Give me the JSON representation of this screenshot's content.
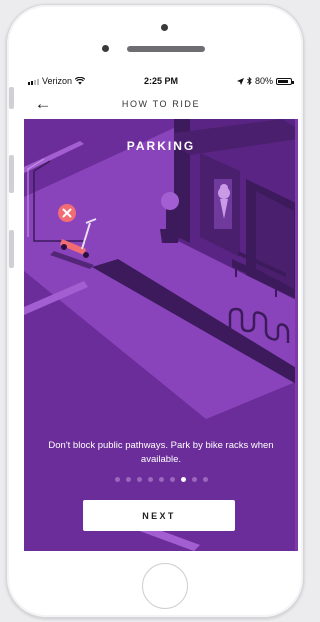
{
  "status_bar": {
    "carrier": "Verizon",
    "time": "2:25 PM",
    "battery": "80%"
  },
  "nav": {
    "back_icon": "arrow-left-icon",
    "title": "HOW TO RIDE"
  },
  "slide": {
    "title": "PARKING",
    "message": "Don't block public pathways. Park by bike racks when available.",
    "page_indicator": {
      "total": 9,
      "active_index": 6
    },
    "next_label": "NEXT"
  },
  "colors": {
    "background_purple": "#6b2d99",
    "street_purple": "#8a44bb",
    "dark_purple": "#3d1a5c",
    "error_red": "#f26c74",
    "button_white": "#ffffff"
  }
}
